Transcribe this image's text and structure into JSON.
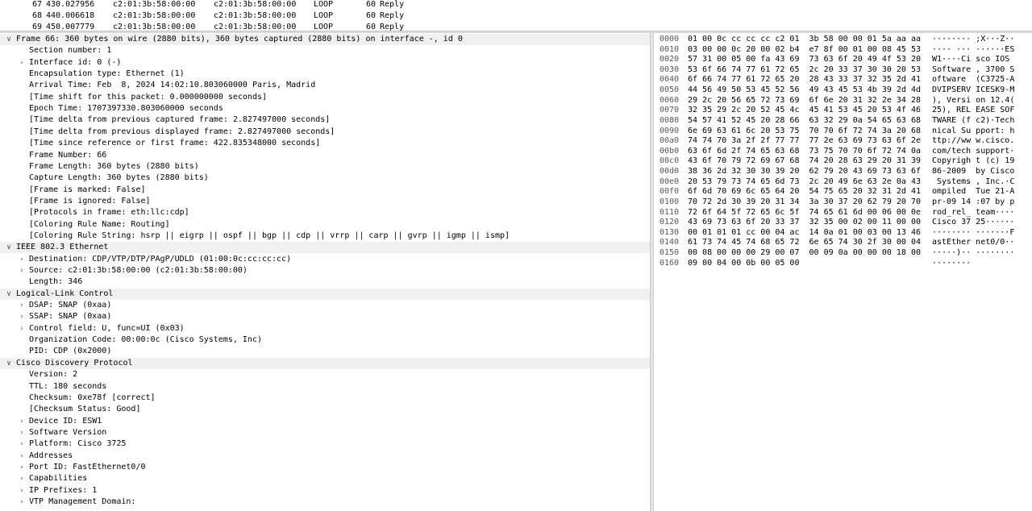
{
  "packet_list": {
    "rows": [
      {
        "no": "67",
        "time": "430.027956",
        "src": "c2:01:3b:58:00:00",
        "dst": "c2:01:3b:58:00:00",
        "proto": "LOOP",
        "len": "60",
        "info": "Reply"
      },
      {
        "no": "68",
        "time": "440.006618",
        "src": "c2:01:3b:58:00:00",
        "dst": "c2:01:3b:58:00:00",
        "proto": "LOOP",
        "len": "60",
        "info": "Reply"
      },
      {
        "no": "69",
        "time": "450.007779",
        "src": "c2:01:3b:58:00:00",
        "dst": "c2:01:3b:58:00:00",
        "proto": "LOOP",
        "len": "60",
        "info": "Reply"
      }
    ]
  },
  "details": {
    "rows": [
      {
        "level": 0,
        "tw": "open",
        "text": "Frame 66: 360 bytes on wire (2880 bits), 360 bytes captured (2880 bits) on interface -, id 0",
        "kind": "hdr"
      },
      {
        "level": 1,
        "tw": "",
        "text": "Section number: 1"
      },
      {
        "level": 1,
        "tw": "closed",
        "text": "Interface id: 0 (-)"
      },
      {
        "level": 1,
        "tw": "",
        "text": "Encapsulation type: Ethernet (1)"
      },
      {
        "level": 1,
        "tw": "",
        "text": "Arrival Time: Feb  8, 2024 14:02:10.803060000 Paris, Madrid"
      },
      {
        "level": 1,
        "tw": "",
        "text": "[Time shift for this packet: 0.000000000 seconds]"
      },
      {
        "level": 1,
        "tw": "",
        "text": "Epoch Time: 1707397330.803060000 seconds"
      },
      {
        "level": 1,
        "tw": "",
        "text": "[Time delta from previous captured frame: 2.827497000 seconds]"
      },
      {
        "level": 1,
        "tw": "",
        "text": "[Time delta from previous displayed frame: 2.827497000 seconds]"
      },
      {
        "level": 1,
        "tw": "",
        "text": "[Time since reference or first frame: 422.835348000 seconds]"
      },
      {
        "level": 1,
        "tw": "",
        "text": "Frame Number: 66"
      },
      {
        "level": 1,
        "tw": "",
        "text": "Frame Length: 360 bytes (2880 bits)"
      },
      {
        "level": 1,
        "tw": "",
        "text": "Capture Length: 360 bytes (2880 bits)"
      },
      {
        "level": 1,
        "tw": "",
        "text": "[Frame is marked: False]"
      },
      {
        "level": 1,
        "tw": "",
        "text": "[Frame is ignored: False]"
      },
      {
        "level": 1,
        "tw": "",
        "text": "[Protocols in frame: eth:llc:cdp]"
      },
      {
        "level": 1,
        "tw": "",
        "text": "[Coloring Rule Name: Routing]"
      },
      {
        "level": 1,
        "tw": "",
        "text": "[Coloring Rule String: hsrp || eigrp || ospf || bgp || cdp || vrrp || carp || gvrp || igmp || ismp]"
      },
      {
        "level": 0,
        "tw": "open",
        "text": "IEEE 802.3 Ethernet",
        "kind": "hdr"
      },
      {
        "level": 1,
        "tw": "closed",
        "text": "Destination: CDP/VTP/DTP/PAgP/UDLD (01:00:0c:cc:cc:cc)"
      },
      {
        "level": 1,
        "tw": "closed",
        "text": "Source: c2:01:3b:58:00:00 (c2:01:3b:58:00:00)"
      },
      {
        "level": 1,
        "tw": "",
        "text": "Length: 346"
      },
      {
        "level": 0,
        "tw": "open",
        "text": "Logical-Link Control",
        "kind": "hdr"
      },
      {
        "level": 1,
        "tw": "closed",
        "text": "DSAP: SNAP (0xaa)"
      },
      {
        "level": 1,
        "tw": "closed",
        "text": "SSAP: SNAP (0xaa)"
      },
      {
        "level": 1,
        "tw": "closed",
        "text": "Control field: U, func=UI (0x03)"
      },
      {
        "level": 1,
        "tw": "",
        "text": "Organization Code: 00:00:0c (Cisco Systems, Inc)"
      },
      {
        "level": 1,
        "tw": "",
        "text": "PID: CDP (0x2000)"
      },
      {
        "level": 0,
        "tw": "open",
        "text": "Cisco Discovery Protocol",
        "kind": "hdr"
      },
      {
        "level": 1,
        "tw": "",
        "text": "Version: 2"
      },
      {
        "level": 1,
        "tw": "",
        "text": "TTL: 180 seconds"
      },
      {
        "level": 1,
        "tw": "",
        "text": "Checksum: 0xe78f [correct]"
      },
      {
        "level": 1,
        "tw": "",
        "text": "[Checksum Status: Good]"
      },
      {
        "level": 1,
        "tw": "closed",
        "text": "Device ID: ESW1"
      },
      {
        "level": 1,
        "tw": "closed",
        "text": "Software Version"
      },
      {
        "level": 1,
        "tw": "closed",
        "text": "Platform: Cisco 3725"
      },
      {
        "level": 1,
        "tw": "closed",
        "text": "Addresses"
      },
      {
        "level": 1,
        "tw": "closed",
        "text": "Port ID: FastEthernet0/0"
      },
      {
        "level": 1,
        "tw": "closed",
        "text": "Capabilities"
      },
      {
        "level": 1,
        "tw": "closed",
        "text": "IP Prefixes: 1"
      },
      {
        "level": 1,
        "tw": "closed",
        "text": "VTP Management Domain:"
      }
    ]
  },
  "bytes": {
    "rows": [
      {
        "offset": "0000",
        "hex": "01 00 0c cc cc cc c2 01  3b 58 00 00 01 5a aa aa",
        "ascii": "········ ;X···Z··"
      },
      {
        "offset": "0010",
        "hex": "03 00 00 0c 20 00 02 b4  e7 8f 00 01 00 08 45 53",
        "ascii": "···· ··· ······ES"
      },
      {
        "offset": "0020",
        "hex": "57 31 00 05 00 fa 43 69  73 63 6f 20 49 4f 53 20",
        "ascii": "W1····Ci sco IOS "
      },
      {
        "offset": "0030",
        "hex": "53 6f 66 74 77 61 72 65  2c 20 33 37 30 30 20 53",
        "ascii": "Software , 3700 S"
      },
      {
        "offset": "0040",
        "hex": "6f 66 74 77 61 72 65 20  28 43 33 37 32 35 2d 41",
        "ascii": "oftware  (C3725-A"
      },
      {
        "offset": "0050",
        "hex": "44 56 49 50 53 45 52 56  49 43 45 53 4b 39 2d 4d",
        "ascii": "DVIPSERV ICESK9-M"
      },
      {
        "offset": "0060",
        "hex": "29 2c 20 56 65 72 73 69  6f 6e 20 31 32 2e 34 28",
        "ascii": "), Versi on 12.4("
      },
      {
        "offset": "0070",
        "hex": "32 35 29 2c 20 52 45 4c  45 41 53 45 20 53 4f 46",
        "ascii": "25), REL EASE SOF"
      },
      {
        "offset": "0080",
        "hex": "54 57 41 52 45 20 28 66  63 32 29 0a 54 65 63 68",
        "ascii": "TWARE (f c2)·Tech"
      },
      {
        "offset": "0090",
        "hex": "6e 69 63 61 6c 20 53 75  70 70 6f 72 74 3a 20 68",
        "ascii": "nical Su pport: h"
      },
      {
        "offset": "00a0",
        "hex": "74 74 70 3a 2f 2f 77 77  77 2e 63 69 73 63 6f 2e",
        "ascii": "ttp://ww w.cisco."
      },
      {
        "offset": "00b0",
        "hex": "63 6f 6d 2f 74 65 63 68  73 75 70 70 6f 72 74 0a",
        "ascii": "com/tech support·"
      },
      {
        "offset": "00c0",
        "hex": "43 6f 70 79 72 69 67 68  74 20 28 63 29 20 31 39",
        "ascii": "Copyrigh t (c) 19"
      },
      {
        "offset": "00d0",
        "hex": "38 36 2d 32 30 30 39 20  62 79 20 43 69 73 63 6f",
        "ascii": "86-2009  by Cisco"
      },
      {
        "offset": "00e0",
        "hex": "20 53 79 73 74 65 6d 73  2c 20 49 6e 63 2e 0a 43",
        "ascii": " Systems , Inc.·C"
      },
      {
        "offset": "00f0",
        "hex": "6f 6d 70 69 6c 65 64 20  54 75 65 20 32 31 2d 41",
        "ascii": "ompiled  Tue 21-A"
      },
      {
        "offset": "0100",
        "hex": "70 72 2d 30 39 20 31 34  3a 30 37 20 62 79 20 70",
        "ascii": "pr-09 14 :07 by p"
      },
      {
        "offset": "0110",
        "hex": "72 6f 64 5f 72 65 6c 5f  74 65 61 6d 00 06 00 0e",
        "ascii": "rod_rel_ team····"
      },
      {
        "offset": "0120",
        "hex": "43 69 73 63 6f 20 33 37  32 35 00 02 00 11 00 00",
        "ascii": "Cisco 37 25······"
      },
      {
        "offset": "0130",
        "hex": "00 01 01 01 cc 00 04 ac  14 0a 01 00 03 00 13 46",
        "ascii": "········ ·······F"
      },
      {
        "offset": "0140",
        "hex": "61 73 74 45 74 68 65 72  6e 65 74 30 2f 30 00 04",
        "ascii": "astEther net0/0··"
      },
      {
        "offset": "0150",
        "hex": "00 08 00 00 00 29 00 07  00 09 0a 00 00 00 18 00",
        "ascii": "·····)·· ········"
      },
      {
        "offset": "0160",
        "hex": "09 00 04 00 0b 00 05 00",
        "ascii": "········"
      }
    ]
  }
}
